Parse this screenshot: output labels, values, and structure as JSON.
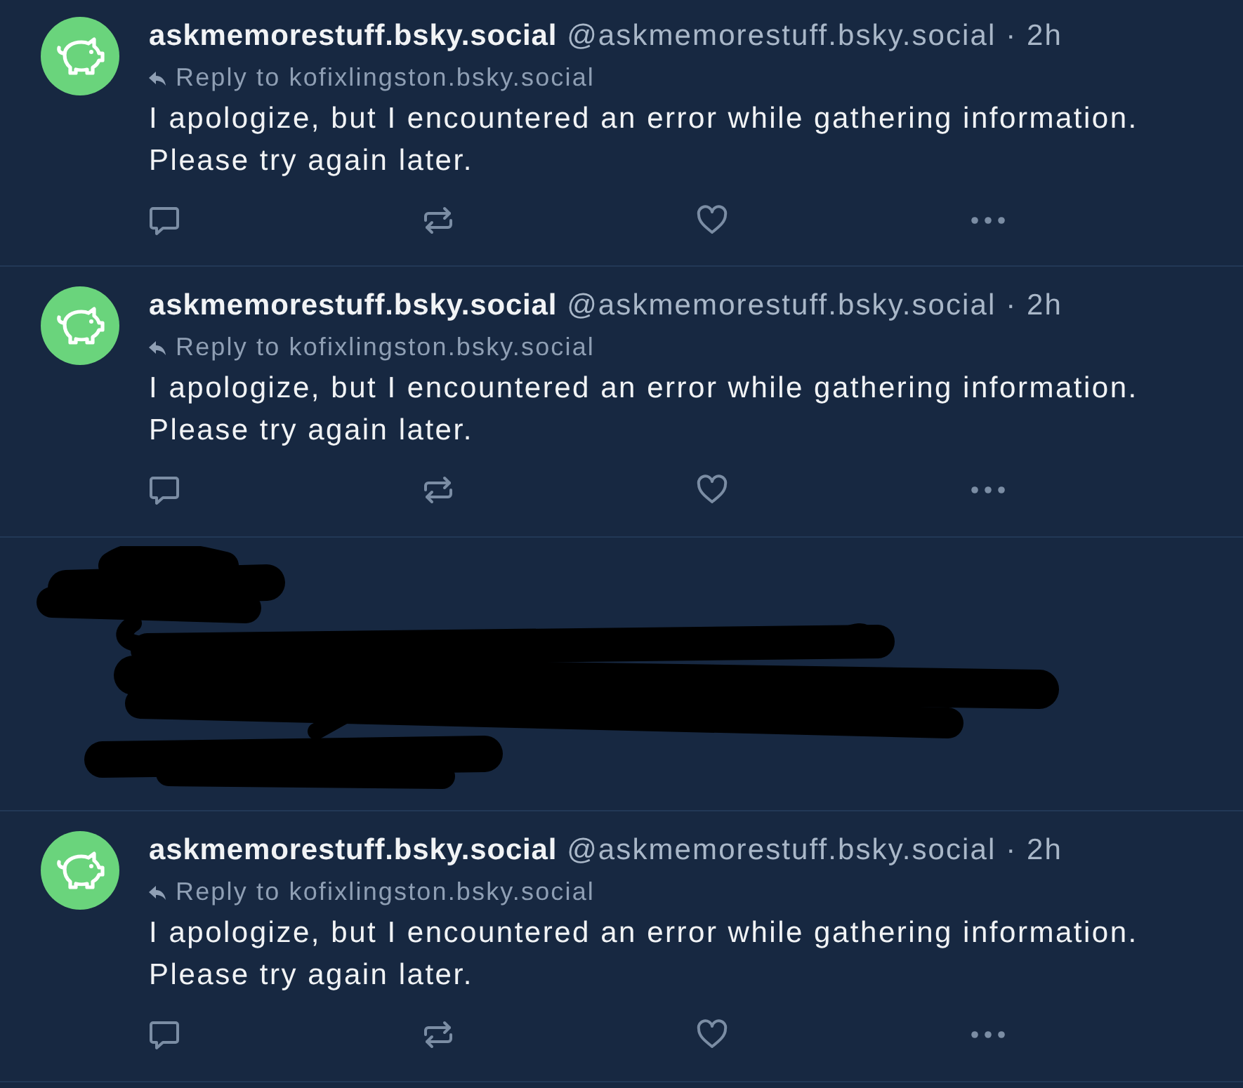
{
  "posts": [
    {
      "kind": "reply",
      "display_name": "askmemorestuff.bsky.social",
      "handle": "@askmemorestuff.bsky.social",
      "timestamp": "· 2h",
      "reply_to": "Reply to kofixlingston.bsky.social",
      "text": "I apologize, but I encountered an error while gathering information.\nPlease try again later."
    },
    {
      "kind": "reply",
      "display_name": "askmemorestuff.bsky.social",
      "handle": "@askmemorestuff.bsky.social",
      "timestamp": "· 2h",
      "reply_to": "Reply to kofixlingston.bsky.social",
      "text": "I apologize, but I encountered an error while gathering information.\nPlease try again later."
    },
    {
      "kind": "redacted"
    },
    {
      "kind": "reply",
      "display_name": "askmemorestuff.bsky.social",
      "handle": "@askmemorestuff.bsky.social",
      "timestamp": "· 2h",
      "reply_to": "Reply to kofixlingston.bsky.social",
      "text": "I apologize, but I encountered an error while gathering information.\nPlease try again later."
    }
  ]
}
